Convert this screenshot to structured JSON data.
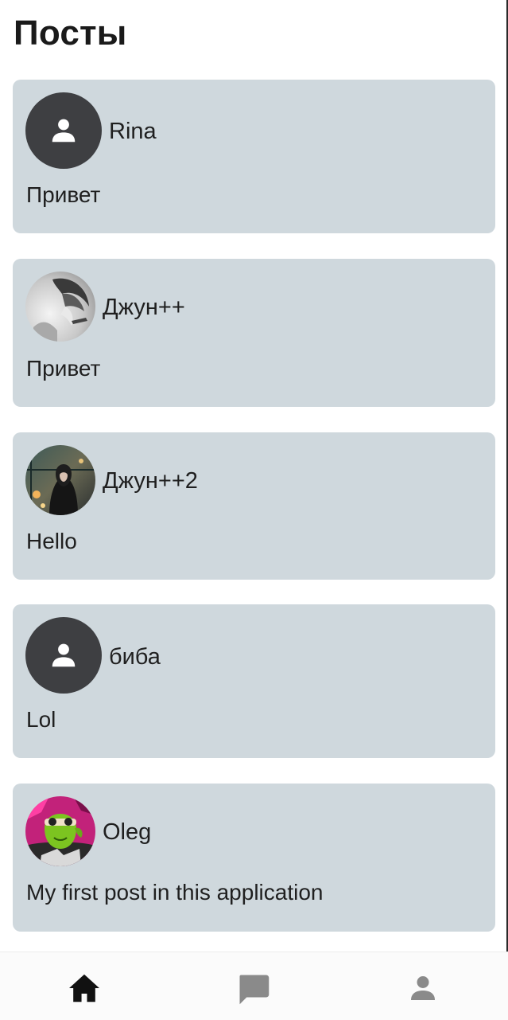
{
  "header": {
    "title": "Посты"
  },
  "posts": [
    {
      "author": "Rina",
      "text": "Привет",
      "avatar": "default-person-icon"
    },
    {
      "author": "Джун++",
      "text": "Привет",
      "avatar": "photo-anime-hooded-figure"
    },
    {
      "author": "Джун++2",
      "text": "Hello",
      "avatar": "photo-hooded-figure-night-window"
    },
    {
      "author": "биба",
      "text": "Lol",
      "avatar": "default-person-icon"
    },
    {
      "author": "Oleg",
      "text": "My first post in this application",
      "avatar": "photo-green-ogre-sunglasses"
    }
  ],
  "bottom_nav": {
    "items": [
      {
        "icon": "home-icon",
        "active": true
      },
      {
        "icon": "chat-icon",
        "active": false
      },
      {
        "icon": "profile-icon",
        "active": false
      }
    ]
  },
  "colors": {
    "card_background": "#cfd8dd",
    "avatar_default_bg": "#3e3f42",
    "nav_active": "#111111",
    "nav_inactive": "#8a8a8a"
  }
}
